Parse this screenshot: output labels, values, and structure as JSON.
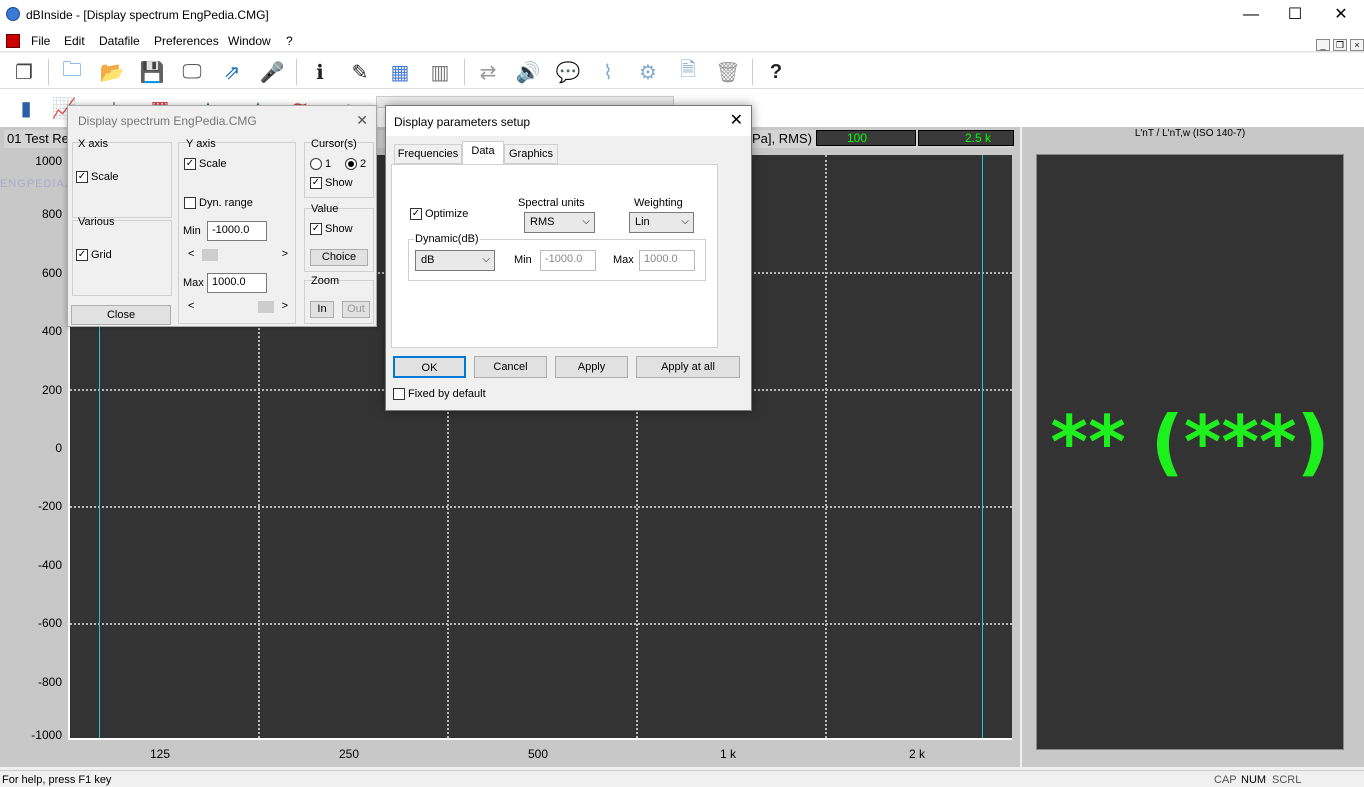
{
  "window": {
    "title": "dBInside - [Display spectrum EngPedia.CMG]",
    "minimize": "—",
    "maximize": "☐",
    "close": "✕"
  },
  "menu": {
    "items": [
      "File",
      "Edit",
      "Datafile",
      "Preferences",
      "Window",
      "?"
    ],
    "mdi_min": "_",
    "mdi_restore": "❐",
    "mdi_close": "×"
  },
  "toolbar1": [
    {
      "name": "windows-icon",
      "glyph": "❐"
    },
    {
      "name": "new-folder-icon",
      "glyph": "🗀"
    },
    {
      "name": "open-folder-icon",
      "glyph": "📂"
    },
    {
      "name": "save-icon",
      "glyph": "💾"
    },
    {
      "name": "device-icon",
      "glyph": "🖵"
    },
    {
      "name": "folder-arrow-icon",
      "glyph": "⇗"
    },
    {
      "name": "microphone-icon",
      "glyph": "🎤"
    },
    {
      "name": "info-icon",
      "glyph": "ℹ"
    },
    {
      "name": "pencil-icon",
      "glyph": "✎"
    },
    {
      "name": "spectrum-icon",
      "glyph": "▦"
    },
    {
      "name": "table-icon",
      "glyph": "▥"
    },
    {
      "name": "export-icon",
      "glyph": "⇄"
    },
    {
      "name": "speaker-icon",
      "glyph": "🔊"
    },
    {
      "name": "chat-icon",
      "glyph": "💬"
    },
    {
      "name": "filter-icon",
      "glyph": "⌇"
    },
    {
      "name": "calc-icon",
      "glyph": "⚙"
    },
    {
      "name": "document-icon",
      "glyph": "🗎"
    },
    {
      "name": "trash-icon",
      "glyph": "🗑"
    },
    {
      "name": "help-icon",
      "glyph": "?"
    }
  ],
  "toolbar2": [
    {
      "name": "bars-gear-icon",
      "glyph": "▮"
    },
    {
      "name": "chart-line-icon",
      "glyph": "📈"
    },
    {
      "name": "plus-icon",
      "glyph": "+"
    },
    {
      "name": "colors-icon",
      "glyph": "▩"
    },
    {
      "name": "peaks-icon",
      "glyph": "▲"
    },
    {
      "name": "peak-icon",
      "glyph": "△"
    },
    {
      "name": "stripes-icon",
      "glyph": "≋"
    },
    {
      "name": "marker-icon",
      "glyph": "✒"
    }
  ],
  "spectrum": {
    "label": "01 Test Re",
    "unit_label": "Pa], RMS)",
    "box1": "100",
    "box2": "2.5 k",
    "yticks": [
      "1000",
      "800",
      "600",
      "400",
      "200",
      "0",
      "-200",
      "-400",
      "-600",
      "-800",
      "-1000"
    ],
    "xticks": [
      "125",
      "250",
      "500",
      "1 k",
      "2 k"
    ],
    "watermark": "ENGPEDIA.IR"
  },
  "right_panel": {
    "title": "L'nT / L'nT,w (ISO 140-7)",
    "value": "** (***)"
  },
  "status": {
    "help": "For help, press F1 key",
    "cap": "CAP",
    "num": "NUM",
    "scrl": "SCRL"
  },
  "ds_dialog": {
    "title": "Display spectrum EngPedia.CMG",
    "close_icon": "✕",
    "x_axis": "X axis",
    "scale": "Scale",
    "various": "Various",
    "grid": "Grid",
    "close_btn": "Close",
    "y_axis": "Y axis",
    "y_scale": "Scale",
    "dyn_range": "Dyn. range",
    "min_label": "Min",
    "min_value": "-1000.0",
    "max_label": "Max",
    "max_value": "1000.0",
    "cursors": "Cursor(s)",
    "c1": "1",
    "c2": "2",
    "c_show": "Show",
    "value_grp": "Value",
    "v_show": "Show",
    "choice": "Choice",
    "zoom": "Zoom",
    "zoom_in": "In",
    "zoom_out": "Out",
    "arrow_left": "<",
    "arrow_right": ">",
    "check": "✓"
  },
  "dp_dialog": {
    "title": "Display parameters setup",
    "close_icon": "✕",
    "tabs": [
      "Frequencies",
      "Data",
      "Graphics"
    ],
    "optimize": "Optimize",
    "spectral_units_label": "Spectral units",
    "spectral_units": "RMS",
    "weighting_label": "Weighting",
    "weighting": "Lin",
    "dynamic_label": "Dynamic(dB)",
    "dynamic": "dB",
    "min_label": "Min",
    "min_value": "-1000.0",
    "max_label": "Max",
    "max_value": "1000.0",
    "ok": "OK",
    "cancel": "Cancel",
    "apply": "Apply",
    "apply_all": "Apply at all",
    "fixed_default": "Fixed by default",
    "arrow": "⌵"
  }
}
